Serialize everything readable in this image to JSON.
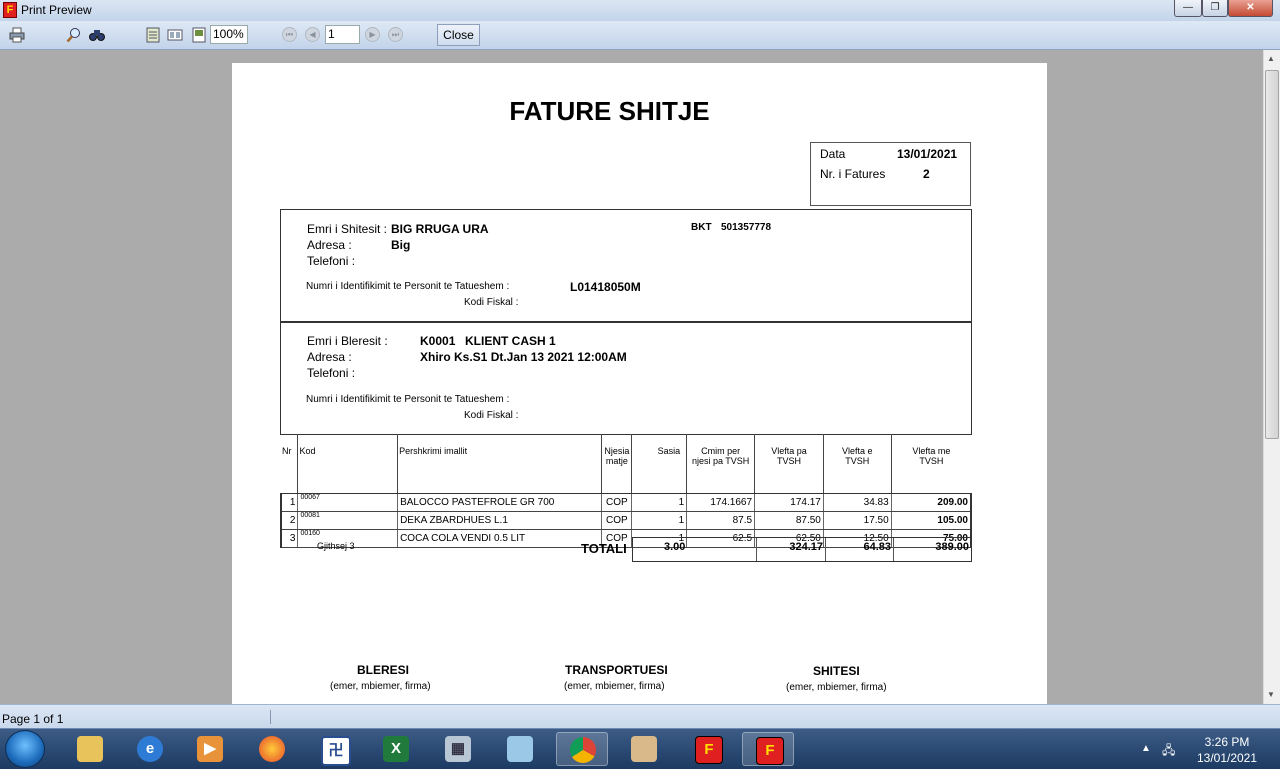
{
  "window": {
    "title": "Print Preview",
    "min": "—",
    "max": "❐",
    "close": "✕"
  },
  "toolbar": {
    "zoom": "100%",
    "page_number": "1",
    "close_label": "Close"
  },
  "invoice": {
    "title": "FATURE SHITJE",
    "date_label": "Data",
    "date_value": "13/01/2021",
    "number_label": "Nr. i Fatures",
    "number_value": "2",
    "seller": {
      "name_label": "Emri i Shitesit :",
      "name_value": "BIG RRUGA URA",
      "bank_label": "BKT",
      "bank_value": "501357778",
      "address_label": "Adresa :",
      "address_value": "Big",
      "phone_label": "Telefoni :",
      "nipt_label": "Numri i Identifikimit te Personit te Tatueshem :",
      "nipt_value": "L01418050M",
      "fiscal_label": "Kodi Fiskal :"
    },
    "buyer": {
      "name_label": "Emri i Bleresit :",
      "code_value": "K0001",
      "name_value": "KLIENT CASH 1",
      "address_label": "Adresa :",
      "address_value": "Xhiro Ks.S1 Dt.Jan 13 2021 12:00AM",
      "phone_label": "Telefoni :",
      "nipt_label": "Numri i Identifikimit te Personit te Tatueshem :",
      "fiscal_label": "Kodi Fiskal :"
    },
    "columns": {
      "nr": "Nr",
      "kod": "Kod",
      "pershkrimi": "Pershkrimi imallit",
      "njesia_1": "Njesia",
      "njesia_2": "matje",
      "sasia": "Sasia",
      "cmim_1": "Cmim per",
      "cmim_2": "njesi pa TVSH",
      "vlefta_pa_1": "Vlefta pa",
      "vlefta_pa_2": "TVSH",
      "vlefta_e_1": "Vlefta e",
      "vlefta_e_2": "TVSH",
      "vlefta_me_1": "Vlefta me",
      "vlefta_me_2": "TVSH"
    },
    "rows": [
      {
        "nr": "1",
        "kod": "00067",
        "desc": "BALOCCO PASTEFROLE GR 700",
        "unit": "COP",
        "qty": "1",
        "price": "174.1667",
        "net": "174.17",
        "vat": "34.83",
        "gross": "209.00"
      },
      {
        "nr": "2",
        "kod": "00081",
        "desc": "DEKA ZBARDHUES L.1",
        "unit": "COP",
        "qty": "1",
        "price": "87.5",
        "net": "87.50",
        "vat": "17.50",
        "gross": "105.00"
      },
      {
        "nr": "3",
        "kod": "00160",
        "desc": "COCA COLA VENDI 0.5 LIT",
        "unit": "COP",
        "qty": "1",
        "price": "62.5",
        "net": "62.50",
        "vat": "12.50",
        "gross": "75.00"
      }
    ],
    "count_label": "Gjithsej 3",
    "totals_label": "TOTALI",
    "totals": {
      "qty": "3.00",
      "net": "324.17",
      "vat": "64.83",
      "gross": "389.00"
    },
    "signatures": [
      {
        "title": "BLERESI",
        "sub": "(emer, mbiemer, firma)"
      },
      {
        "title": "TRANSPORTUESI",
        "sub": "(emer, mbiemer, firma)"
      },
      {
        "title": "SHITESI",
        "sub": "(emer, mbiemer, firma)"
      }
    ]
  },
  "statusbar": {
    "text": "Page 1 of 1"
  },
  "taskbar": {
    "time": "3:26 PM",
    "date": "13/01/2021"
  }
}
